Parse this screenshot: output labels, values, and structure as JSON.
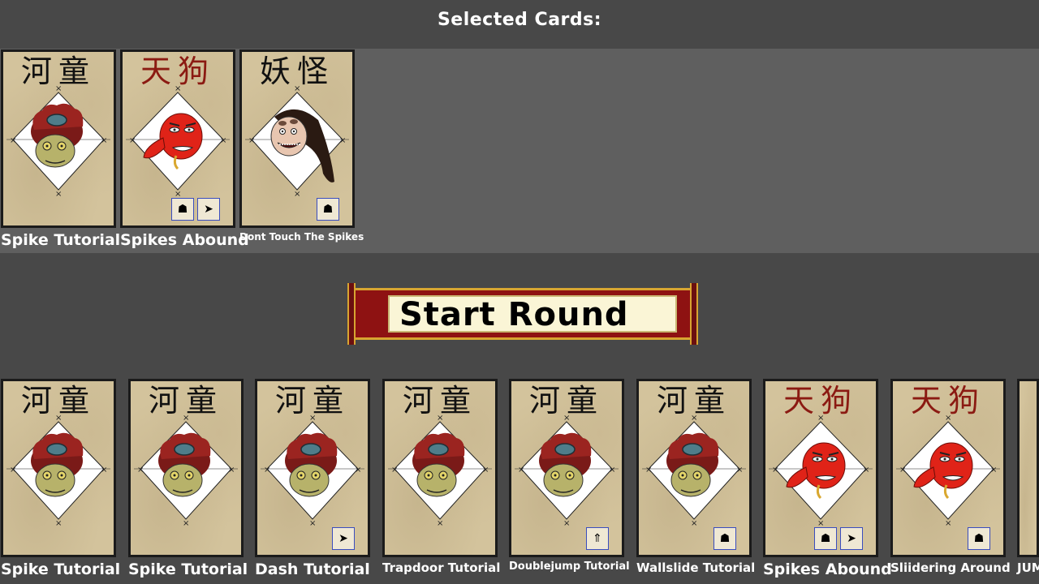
{
  "header": {
    "title": "Selected Cards:"
  },
  "start_button": {
    "label": "Start Round"
  },
  "selected_cards": [
    {
      "label": "Spike Tutorial",
      "kanji": "河童",
      "monster": "kappa",
      "icons": []
    },
    {
      "label": "Spikes Abound",
      "kanji": "天狗",
      "monster": "tengu",
      "icons": [
        "silhouette-icon",
        "dash-icon"
      ]
    },
    {
      "label": "Dont Touch The Spikes",
      "kanji": "妖怪",
      "monster": "yokai",
      "icons": [
        "silhouette-icon"
      ]
    }
  ],
  "deck_cards": [
    {
      "label": "Spike Tutorial",
      "kanji": "河童",
      "monster": "kappa",
      "icons": []
    },
    {
      "label": "Spike Tutorial",
      "kanji": "河童",
      "monster": "kappa",
      "icons": []
    },
    {
      "label": "Dash Tutorial",
      "kanji": "河童",
      "monster": "kappa",
      "icons": [
        "dash-icon"
      ]
    },
    {
      "label": "Trapdoor Tutorial",
      "kanji": "河童",
      "monster": "kappa",
      "icons": []
    },
    {
      "label": "Doublejump Tutorial",
      "kanji": "河童",
      "monster": "kappa",
      "icons": [
        "jump-icon"
      ]
    },
    {
      "label": "Wallslide Tutorial",
      "kanji": "河童",
      "monster": "kappa",
      "icons": [
        "silhouette-icon"
      ]
    },
    {
      "label": "Spikes Abound",
      "kanji": "天狗",
      "monster": "tengu",
      "icons": [
        "silhouette-icon",
        "dash-icon"
      ]
    },
    {
      "label": "Sliidering Around",
      "kanji": "天狗",
      "monster": "tengu",
      "icons": [
        "silhouette-icon"
      ]
    },
    {
      "label": "JUM",
      "kanji": "",
      "monster": "partial",
      "icons": []
    }
  ],
  "colors": {
    "background": "#484848",
    "selected_panel": "#5f5f5f",
    "card_parchment": "#d3c39c",
    "kanji_black": "#111111",
    "kanji_red": "#8b1a12",
    "scroll_red": "#8e1212",
    "scroll_gold": "#d8a531",
    "scroll_paper": "#faf5d6"
  }
}
